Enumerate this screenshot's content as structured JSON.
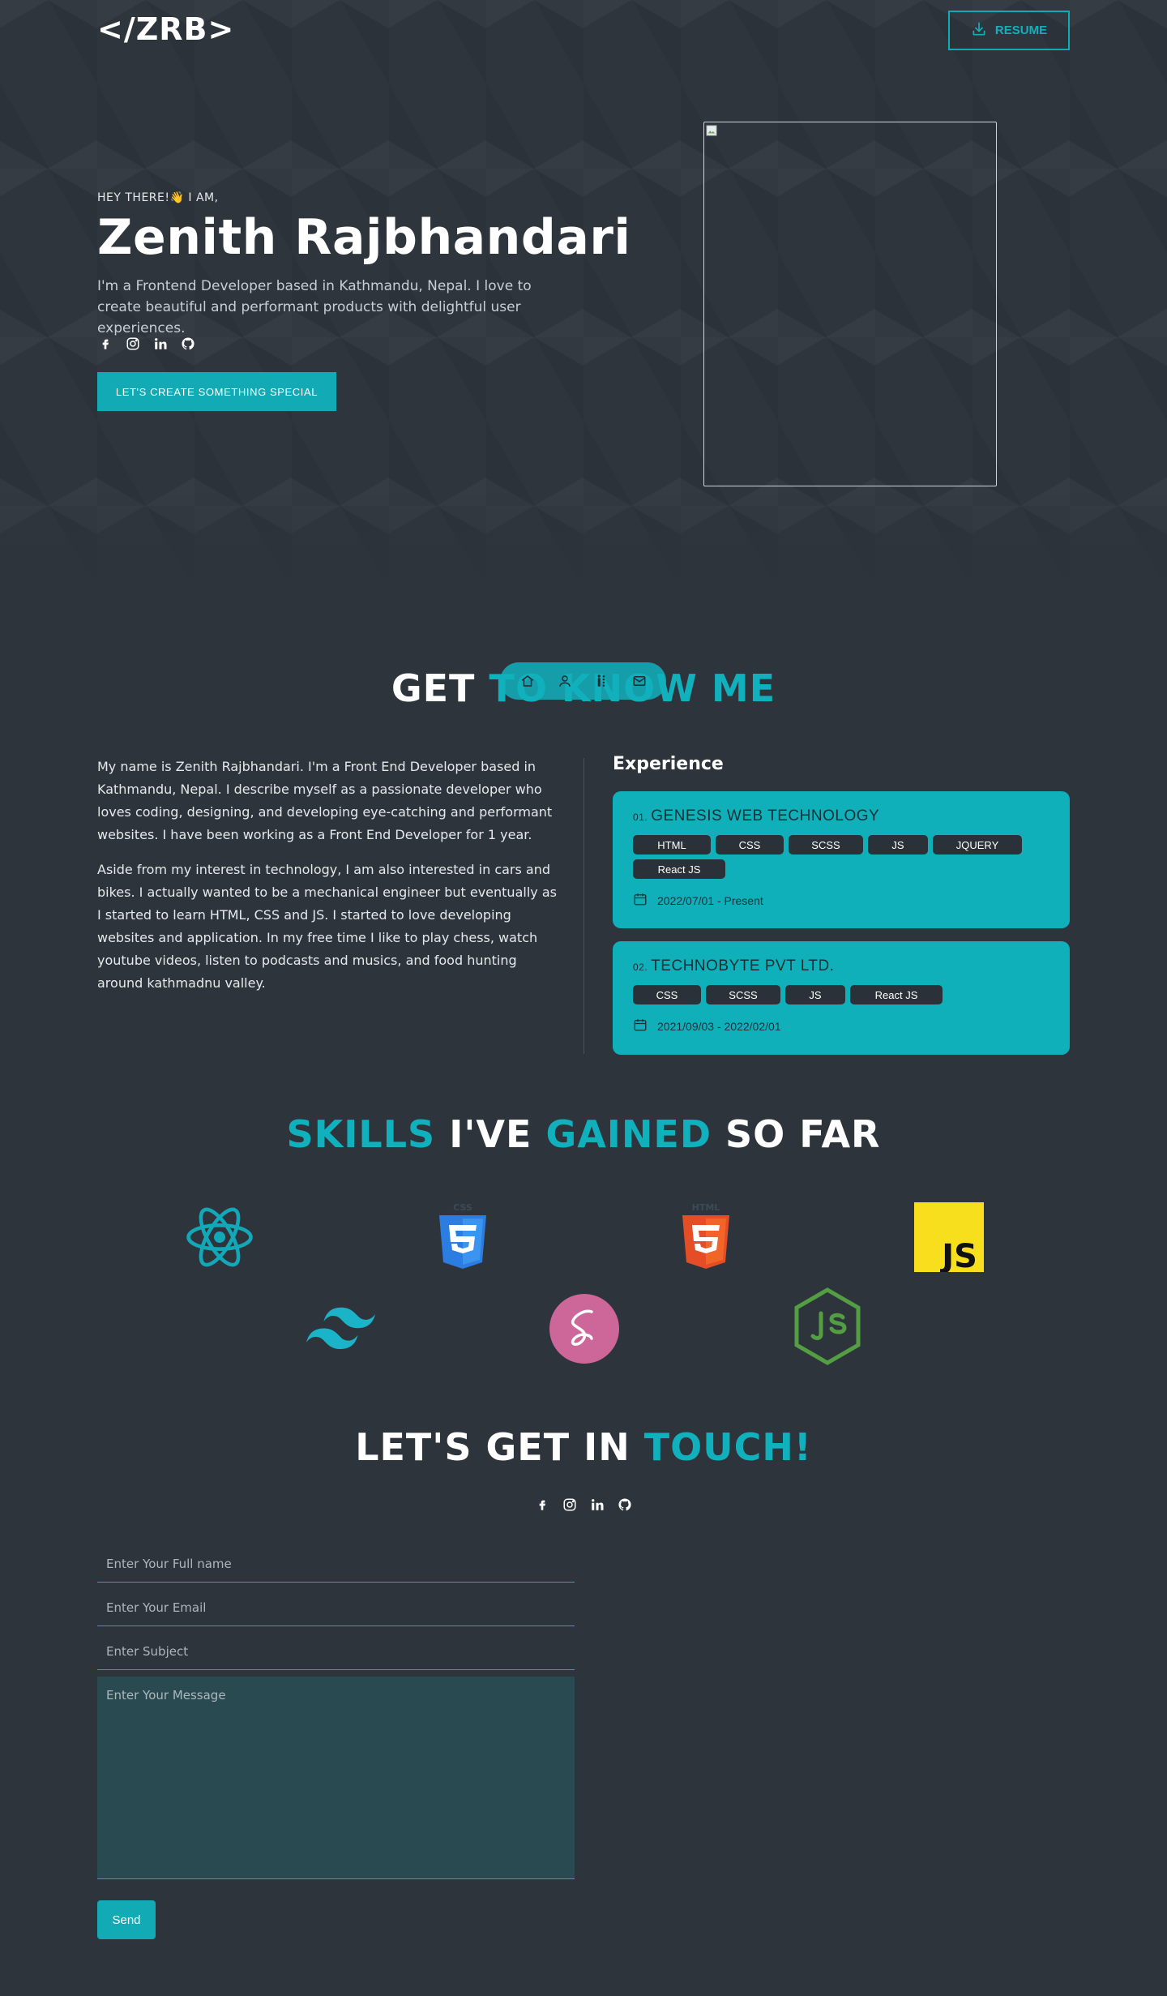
{
  "header": {
    "logo": {
      "bracket_open": "</",
      "slash": "/",
      "text": "ZRB",
      "bracket_close": ">"
    },
    "resume_label": "RESUME"
  },
  "hero": {
    "greeting": "HEY THERE!👋 I AM,",
    "name": "Zenith Rajbhandari",
    "description": "I'm a Frontend Developer based in Kathmandu, Nepal. I love to create beautiful and performant products with delightful user experiences.",
    "socials": [
      "facebook-icon",
      "instagram-icon",
      "linkedin-icon",
      "github-icon"
    ],
    "cta_label": "LET'S CREATE SOMETHING SPECIAL"
  },
  "nav": {
    "icons": [
      "home-icon",
      "user-icon",
      "skills-icon",
      "mail-icon"
    ]
  },
  "about": {
    "title_part1": "GET ",
    "title_part2": "TO KNOW ME",
    "paragraphs": [
      "My name is Zenith Rajbhandari. I'm a Front End Developer based in Kathmandu, Nepal. I describe myself as a passionate developer who loves coding, designing, and developing eye-catching and performant websites. I have been working as a Front End Developer for 1 year.",
      "Aside from my interest in technology, I am also interested in cars and bikes. I actually wanted to be a mechanical engineer but eventually as I started to learn HTML, CSS and JS. I started to love developing websites and application. In my free time I like to play chess, watch youtube videos, listen to podcasts and musics, and food hunting around kathmadnu valley."
    ]
  },
  "experience": {
    "heading": "Experience",
    "items": [
      {
        "num": "01.",
        "company": "GENESIS WEB TECHNOLOGY",
        "tags": [
          "HTML",
          "CSS",
          "SCSS",
          "JS",
          "JQUERY",
          "React JS"
        ],
        "date": "2022/07/01 - Present"
      },
      {
        "num": "02.",
        "company": "TECHNOBYTE PVT LTD.",
        "tags": [
          "CSS",
          "SCSS",
          "JS",
          "React JS"
        ],
        "date": "2021/09/03 - 2022/02/01"
      }
    ]
  },
  "skills": {
    "title_a": "SKILLS",
    "title_b": " I'VE ",
    "title_c": "GAINED",
    "title_d": " SO FAR",
    "css_label": "CSS",
    "html_label": "HTML",
    "js_label": "JS",
    "icons": [
      "react-icon",
      "css3-icon",
      "html5-icon",
      "javascript-icon",
      "tailwind-icon",
      "sass-icon",
      "nodejs-icon"
    ]
  },
  "contact": {
    "title_a": "LET'S GET IN ",
    "title_b": "TOUCH!",
    "fullname_placeholder": "Enter Your Full name",
    "email_placeholder": "Enter Your Email",
    "subject_placeholder": "Enter Subject",
    "message_placeholder": "Enter Your Message",
    "send_label": "Send"
  },
  "colors": {
    "accent": "#10b0bc",
    "background": "#2e343c",
    "tag_bg": "#2b3138"
  }
}
